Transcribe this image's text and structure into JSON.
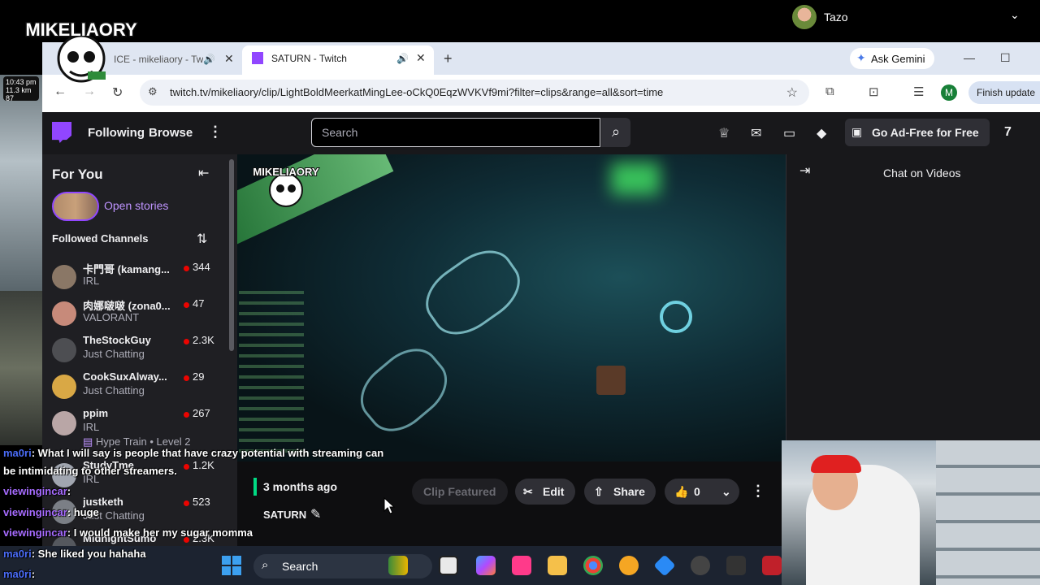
{
  "profile": {
    "name": "Tazo"
  },
  "logo_text": "MIKELIAORY",
  "browser": {
    "tabs": [
      {
        "title": "ICE - mikeliaory - Twi",
        "active": false
      },
      {
        "title": "SATURN - Twitch",
        "active": true
      }
    ],
    "ask_gemini": "Ask Gemini",
    "url": "twitch.tv/mikeliaory/clip/LightBoldMeerkatMingLee-oCkQ0EqzWVKVf9mi?filter=clips&range=all&sort=time",
    "profile_initial": "M",
    "finish_update": "Finish update"
  },
  "twitch": {
    "nav": {
      "following": "Following",
      "browse": "Browse",
      "search_placeholder": "Search",
      "ad_free": "Go Ad-Free for Free"
    },
    "sidebar": {
      "title": "For You",
      "stories": "Open stories",
      "followed_title": "Followed Channels",
      "channels": [
        {
          "name": "卡門哥 (kamang...",
          "category": "IRL",
          "viewers": "344"
        },
        {
          "name": "肉娜啵啵 (zona0...",
          "category": "VALORANT",
          "viewers": "47"
        },
        {
          "name": "TheStockGuy",
          "category": "Just Chatting",
          "viewers": "2.3K"
        },
        {
          "name": "CookSuxAlway...",
          "category": "Just Chatting",
          "viewers": "29"
        },
        {
          "name": "ppim",
          "category": "IRL",
          "viewers": "267",
          "extra": "Hype Train • Level 2"
        },
        {
          "name": "StudyTme",
          "category": "IRL",
          "viewers": "1.2K"
        },
        {
          "name": "justketh",
          "category": "Just Chatting",
          "viewers": "523"
        },
        {
          "name": "MidnightSumo",
          "category": "IRL",
          "viewers": "2.3K"
        }
      ]
    },
    "clip": {
      "age": "3 months ago",
      "title": "SATURN",
      "featured": "Clip Featured",
      "edit": "Edit",
      "share": "Share",
      "likes": "0"
    },
    "chat_panel": {
      "title": "Chat on Videos"
    }
  },
  "overlay_chat": [
    {
      "user": "ma0ri",
      "text": ": What I will say is people that have crazy potential with streaming can"
    },
    {
      "user": "",
      "text": "be intimidating to other streamers."
    },
    {
      "user": "viewingincar",
      "text": ":"
    },
    {
      "user": "viewingincar",
      "text": ": huge"
    },
    {
      "user": "viewingincar",
      "text": ": I would make her my sugar momma"
    },
    {
      "user": "ma0ri",
      "text": ": She liked you hahaha"
    },
    {
      "user": "ma0ri",
      "text": ":"
    }
  ],
  "phone_widget": {
    "time": "10:43 pm",
    "line2": "11.3 km",
    "hr": "87"
  },
  "taskbar": {
    "search": "Search"
  }
}
